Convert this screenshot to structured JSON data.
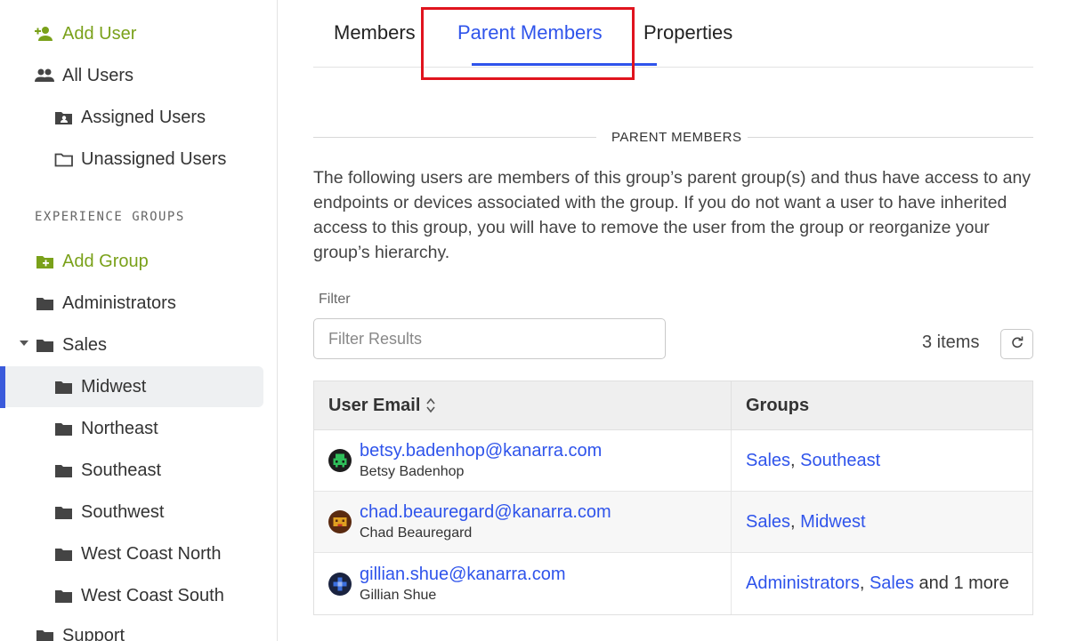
{
  "sidebar": {
    "add_user": "Add User",
    "all_users": "All Users",
    "assigned_users": "Assigned Users",
    "unassigned_users": "Unassigned Users",
    "groups_heading": "EXPERIENCE GROUPS",
    "add_group": "Add Group",
    "groups": [
      {
        "label": "Administrators",
        "icon": "folder-icon"
      },
      {
        "label": "Sales",
        "icon": "folder-icon",
        "expanded": true
      },
      {
        "label": "Midwest",
        "icon": "folder-icon",
        "selected": true
      },
      {
        "label": "Northeast",
        "icon": "folder-icon"
      },
      {
        "label": "Southeast",
        "icon": "folder-icon"
      },
      {
        "label": "Southwest",
        "icon": "folder-icon"
      },
      {
        "label": "West Coast North",
        "icon": "folder-icon"
      },
      {
        "label": "West Coast South",
        "icon": "folder-icon"
      },
      {
        "label": "Support",
        "icon": "folder-icon"
      }
    ]
  },
  "tabs": [
    {
      "label": "Members"
    },
    {
      "label": "Parent Members",
      "active": true
    },
    {
      "label": "Properties"
    }
  ],
  "section": {
    "title": "PARENT MEMBERS",
    "description": "The following users are members of this group’s parent group(s) and thus have access to any endpoints or devices associated with the group. If you do not want a user to have inherited access to this group, you will have to remove the user from the group or reorganize your group’s hierarchy."
  },
  "filter": {
    "label": "Filter",
    "placeholder": "Filter Results",
    "value": ""
  },
  "item_count": "3 items",
  "table": {
    "columns": [
      "User Email",
      "Groups"
    ],
    "rows": [
      {
        "email": "betsy.badenhop@kanarra.com",
        "name": "Betsy Badenhop",
        "groups": [
          "Sales",
          "Southeast"
        ],
        "more": "",
        "avatar_color": "#2fbf5a"
      },
      {
        "email": "chad.beauregard@kanarra.com",
        "name": "Chad Beauregard",
        "groups": [
          "Sales",
          "Midwest"
        ],
        "more": "",
        "avatar_color": "#c98a1a"
      },
      {
        "email": "gillian.shue@kanarra.com",
        "name": "Gillian Shue",
        "groups": [
          "Administrators",
          "Sales"
        ],
        "more": "and 1 more",
        "avatar_color": "#3b6fe0"
      }
    ]
  },
  "colors": {
    "accent": "#2f54eb",
    "add_green": "#7aa11a",
    "highlight_red": "#e0141e",
    "selection_bar": "#3b5bdb"
  }
}
